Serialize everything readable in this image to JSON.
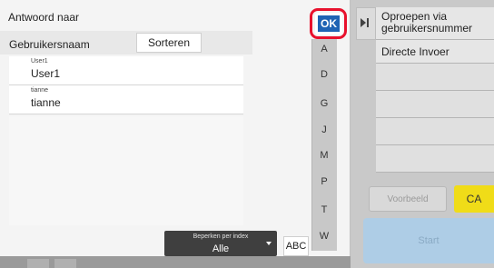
{
  "dialog": {
    "title": "Antwoord naar",
    "column_label": "Gebruikersnaam",
    "sort_label": "Sorteren",
    "ok_label": "OK",
    "abc_label": "ABC",
    "limit": {
      "label": "Beperken per index",
      "value": "Alle"
    }
  },
  "list": [
    {
      "small": "User1",
      "main": "User1"
    },
    {
      "small": "tianne",
      "main": "tianne"
    }
  ],
  "index_letters": [
    "A",
    "D",
    "G",
    "J",
    "M",
    "P",
    "T",
    "W"
  ],
  "right_panel": {
    "items": [
      "Oproepen via gebruikersnummer",
      "Directe Invoer"
    ],
    "preview_label": "Voorbeeld",
    "ca_label": "CA",
    "start_label": "Start"
  },
  "colors": {
    "ok_button": "#1f63b4",
    "highlight_ring": "#e8112d",
    "ca_button": "#f0dc18",
    "start_button": "#aecde6"
  }
}
